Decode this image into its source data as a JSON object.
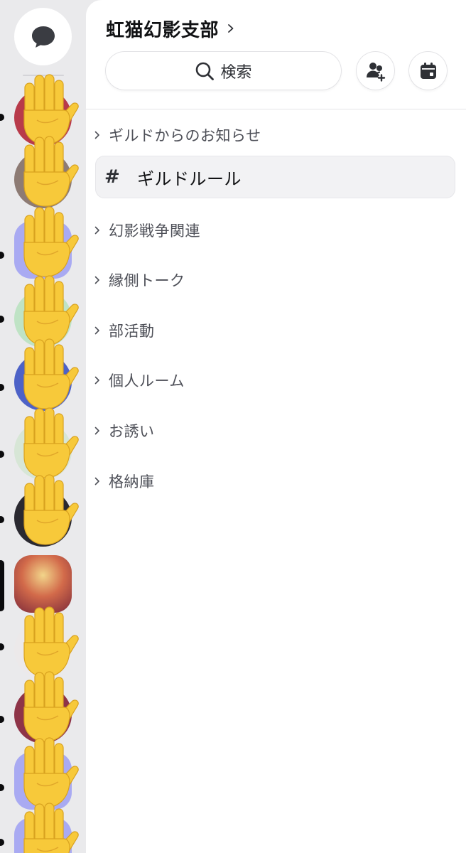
{
  "rail": {
    "dm_icon": "speech-bubble-icon",
    "servers": [
      {
        "name": "server-1",
        "color": "#b83a4a",
        "shape": "circle",
        "indicator": "dot"
      },
      {
        "name": "server-2",
        "color": "#8d7b74",
        "shape": "circle",
        "indicator": "none"
      },
      {
        "name": "server-3",
        "color": "#a9aaf2",
        "shape": "squircle",
        "indicator": "dot"
      },
      {
        "name": "server-4",
        "color": "#bfe3c5",
        "shape": "circle",
        "indicator": "dot"
      },
      {
        "name": "server-5",
        "color": "#4d62c7",
        "shape": "circle",
        "indicator": "dot"
      },
      {
        "name": "server-6",
        "color": "#d7e6d6",
        "shape": "circle",
        "indicator": "dot"
      },
      {
        "name": "server-7",
        "color": "#2a2930",
        "shape": "circle",
        "indicator": "dot"
      },
      {
        "name": "server-8-current",
        "color": "#c24a4a",
        "shape": "squircle",
        "indicator": "active"
      },
      {
        "name": "server-9",
        "color": "#ece9ea",
        "shape": "circle",
        "indicator": "dot"
      },
      {
        "name": "server-10",
        "color": "#8e3448",
        "shape": "circle",
        "indicator": "dot"
      },
      {
        "name": "server-11",
        "color": "#a9aaf2",
        "shape": "squircle",
        "indicator": "dot"
      },
      {
        "name": "server-12",
        "color": "#a9aaf2",
        "shape": "squircle",
        "indicator": "dot"
      }
    ]
  },
  "guild": {
    "name": "虹猫幻影支部"
  },
  "search": {
    "label": "検索"
  },
  "actions": {
    "invite_icon": "add-member-icon",
    "events_icon": "calendar-icon"
  },
  "categories": [
    {
      "label": "ギルドからのお知らせ"
    },
    {
      "label": "幻影戦争関連"
    },
    {
      "label": "縁側トーク"
    },
    {
      "label": "部活動"
    },
    {
      "label": "個人ルーム"
    },
    {
      "label": "お誘い"
    },
    {
      "label": "格納庫"
    }
  ],
  "channel": {
    "hash": "#",
    "label": "ギルドルール"
  },
  "colors": {
    "rail_bg": "#eaeaec",
    "panel_bg": "#ffffff",
    "channel_bg": "#f2f2f4",
    "hand_yellow": "#f7c93a"
  }
}
